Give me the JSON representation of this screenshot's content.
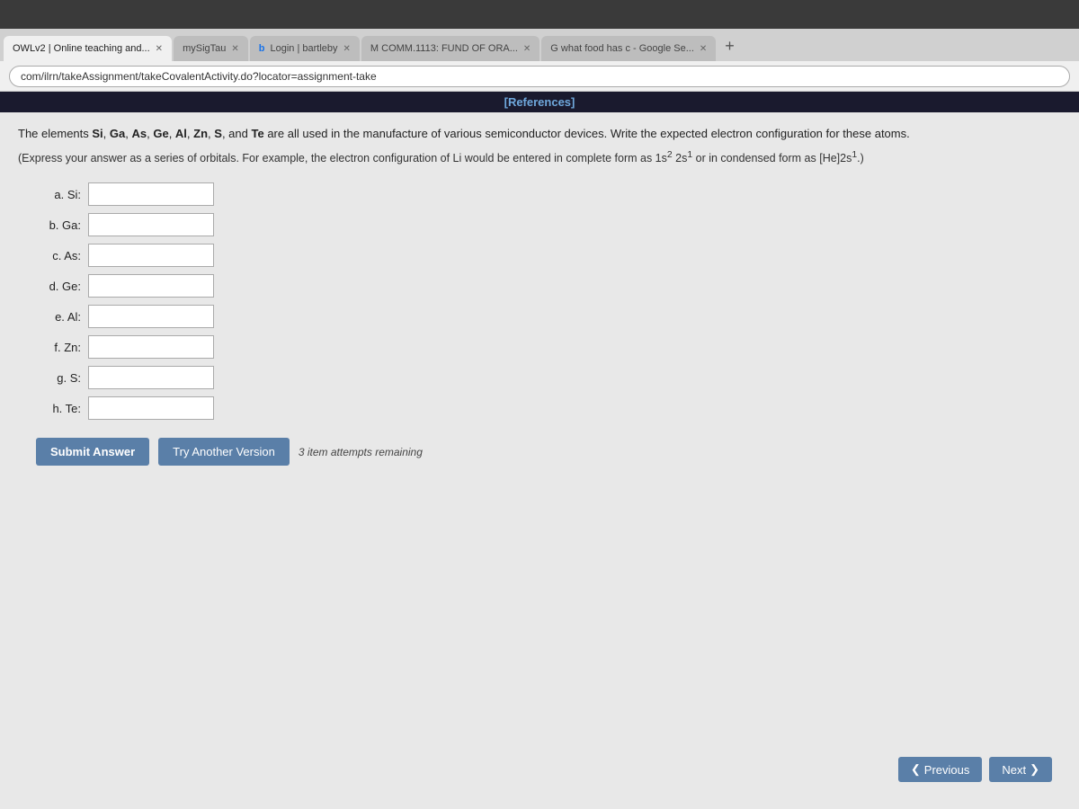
{
  "browser": {
    "tabs": [
      {
        "id": "tab1",
        "label": "OWLv2 | Online teaching and...",
        "active": true
      },
      {
        "id": "tab2",
        "label": "mySigTau",
        "active": false
      },
      {
        "id": "tab3",
        "label": "Login | bartleby",
        "active": false
      },
      {
        "id": "tab4",
        "label": "M COMM.1113: FUND OF ORA...",
        "active": false
      },
      {
        "id": "tab5",
        "label": "G what food has c - Google Se...",
        "active": false
      }
    ],
    "address": "com/ilrn/takeAssignment/takeCovalentActivity.do?locator=assignment-take"
  },
  "page": {
    "references_label": "[References]",
    "question_text": "The elements Si, Ga, As, Ge, Al, Zn, S, and Te are all used in the manufacture of various semiconductor devices. Write the expected electron configuration for these atoms.",
    "instruction_text": "(Express your answer as a series of orbitals. For example, the electron configuration of Li would be entered in complete form as 1s² 2s¹ or in condensed form as [He]2s¹.)",
    "inputs": [
      {
        "label": "a. Si:",
        "id": "si"
      },
      {
        "label": "b. Ga:",
        "id": "ga"
      },
      {
        "label": "c. As:",
        "id": "as"
      },
      {
        "label": "d. Ge:",
        "id": "ge"
      },
      {
        "label": "e. Al:",
        "id": "al"
      },
      {
        "label": "f. Zn:",
        "id": "zn"
      },
      {
        "label": "g. S:",
        "id": "s"
      },
      {
        "label": "h. Te:",
        "id": "te"
      }
    ],
    "submit_label": "Submit Answer",
    "try_another_label": "Try Another Version",
    "attempts_text": "3 item attempts remaining",
    "nav": {
      "previous_label": "Previous",
      "next_label": "Next"
    }
  }
}
